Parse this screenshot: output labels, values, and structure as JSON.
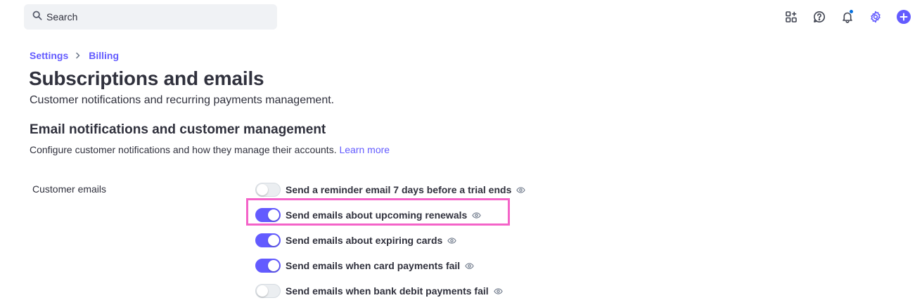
{
  "search": {
    "placeholder": "Search"
  },
  "topbar": {
    "icons": [
      "apps-icon",
      "help-icon",
      "bell-icon",
      "gear-icon",
      "plus-icon"
    ],
    "accent": "#635bff",
    "notification_dot_color": "#0570de"
  },
  "breadcrumb": {
    "items": [
      "Settings",
      "Billing"
    ]
  },
  "page": {
    "title": "Subscriptions and emails",
    "subtitle": "Customer notifications and recurring payments management."
  },
  "section": {
    "title": "Email notifications and customer management",
    "description": "Configure customer notifications and how they manage their accounts.",
    "learn_more": "Learn more"
  },
  "customer_emails": {
    "label": "Customer emails",
    "toggles": [
      {
        "label": "Send a reminder email 7 days before a trial ends",
        "on": false
      },
      {
        "label": "Send emails about upcoming renewals",
        "on": true,
        "highlighted": true
      },
      {
        "label": "Send emails about expiring cards",
        "on": true
      },
      {
        "label": "Send emails when card payments fail",
        "on": true
      },
      {
        "label": "Send emails when bank debit payments fail",
        "on": false
      }
    ]
  },
  "highlight_color": "#f463c8"
}
